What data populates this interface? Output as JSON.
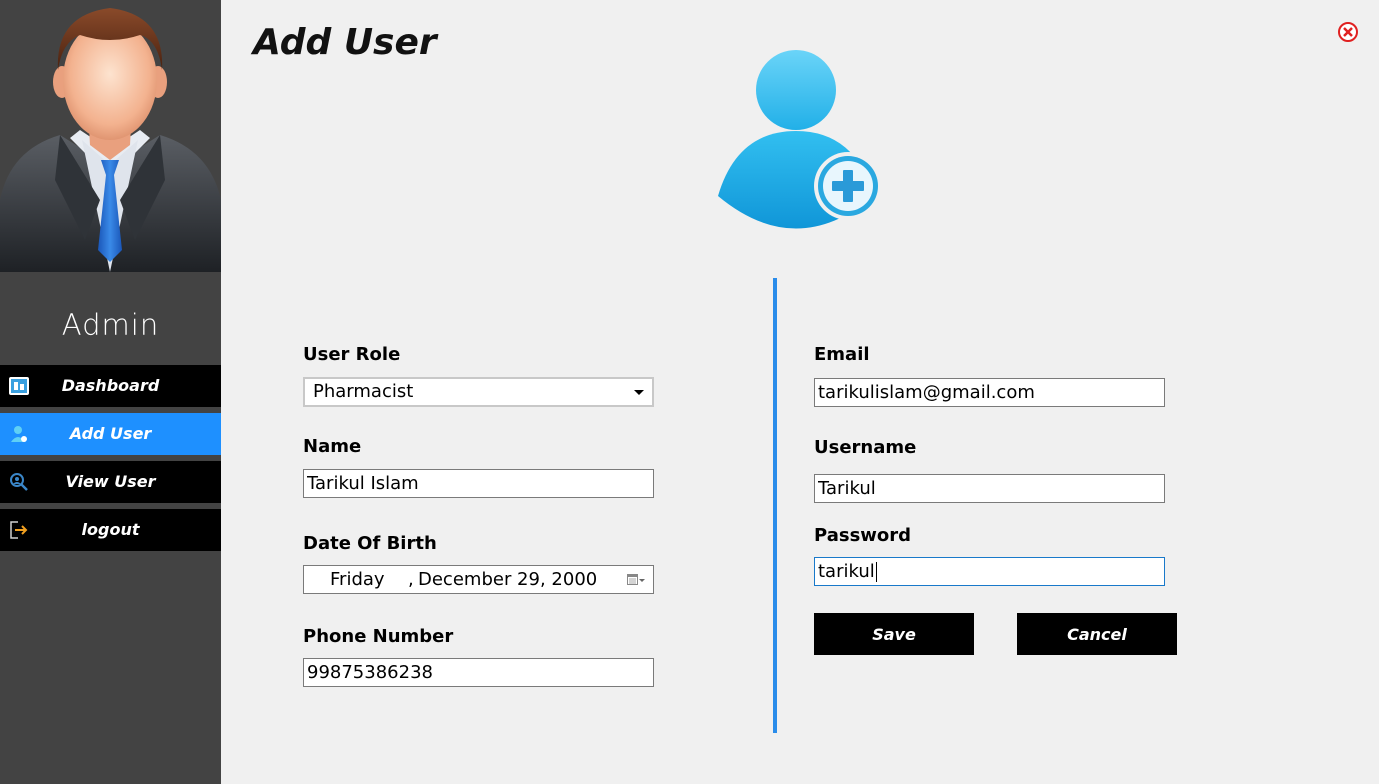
{
  "sidebar": {
    "user_name": "Admin",
    "items": [
      {
        "label": "Dashboard",
        "icon": "dashboard-icon",
        "active": false
      },
      {
        "label": "Add User",
        "icon": "user-icon",
        "active": true
      },
      {
        "label": "View User",
        "icon": "search-user-icon",
        "active": false
      },
      {
        "label": "logout",
        "icon": "logout-icon",
        "active": false
      }
    ]
  },
  "header": {
    "title": "Add User",
    "close_icon": "close-icon"
  },
  "form": {
    "user_role": {
      "label": "User Role",
      "value": "Pharmacist"
    },
    "name": {
      "label": "Name",
      "value": "Tarikul Islam"
    },
    "dob": {
      "label": "Date Of Birth",
      "day": "Friday",
      "date": "December 29, 2000"
    },
    "phone": {
      "label": "Phone Number",
      "value": "99875386238"
    },
    "email": {
      "label": "Email",
      "value": "tarikulislam@gmail.com"
    },
    "username": {
      "label": "Username",
      "value": "Tarikul"
    },
    "password": {
      "label": "Password",
      "value": "tarikul"
    }
  },
  "buttons": {
    "save": "Save",
    "cancel": "Cancel"
  },
  "colors": {
    "sidebar_bg": "#434343",
    "nav_bg": "#000000",
    "nav_active": "#1e90ff",
    "divider": "#2a8cea",
    "page_bg": "#f0f0f0"
  }
}
